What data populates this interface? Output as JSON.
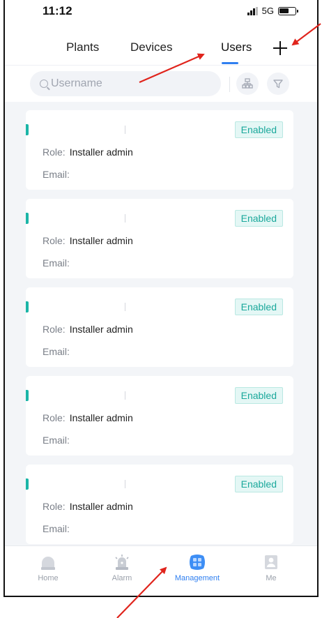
{
  "status_bar": {
    "time": "11:12",
    "network": "5G"
  },
  "tabs": [
    {
      "label": "Plants",
      "active": false
    },
    {
      "label": "Devices",
      "active": false
    },
    {
      "label": "Users",
      "active": true
    }
  ],
  "search": {
    "placeholder": "Username"
  },
  "users": [
    {
      "status": "Enabled",
      "role_label": "Role:",
      "role": "Installer admin",
      "email_label": "Email:"
    },
    {
      "status": "Enabled",
      "role_label": "Role:",
      "role": "Installer admin",
      "email_label": "Email:"
    },
    {
      "status": "Enabled",
      "role_label": "Role:",
      "role": "Installer admin",
      "email_label": "Email:"
    },
    {
      "status": "Enabled",
      "role_label": "Role:",
      "role": "Installer admin",
      "email_label": "Email:"
    },
    {
      "status": "Enabled",
      "role_label": "Role:",
      "role": "Installer admin",
      "email_label": "Email:"
    }
  ],
  "bottom_nav": [
    {
      "label": "Home",
      "icon": "home-icon"
    },
    {
      "label": "Alarm",
      "icon": "alarm-icon"
    },
    {
      "label": "Management",
      "icon": "management-icon",
      "active": true
    },
    {
      "label": "Me",
      "icon": "me-icon"
    }
  ],
  "colors": {
    "accent_blue": "#2f7ff0",
    "status_green": "#1aa89b",
    "annotation_red": "#e0241c"
  }
}
